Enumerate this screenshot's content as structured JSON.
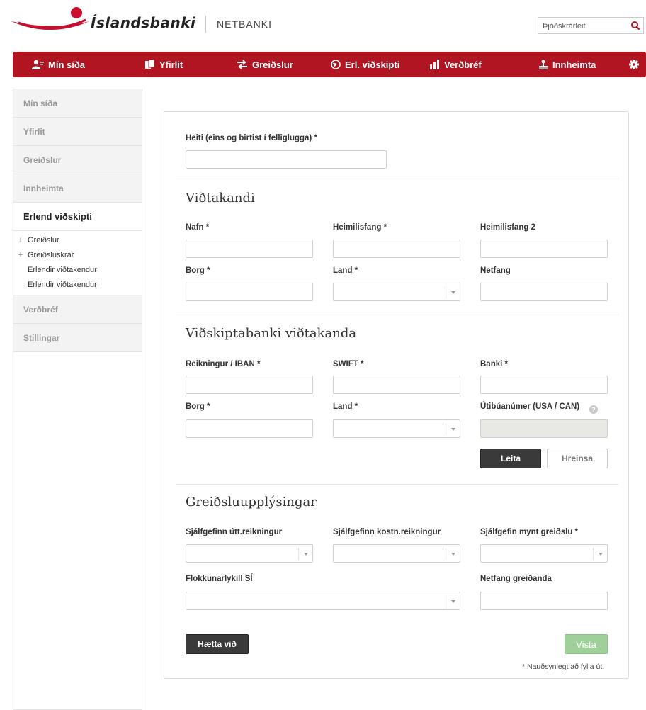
{
  "brand": {
    "name": "Íslandsbanki",
    "product": "NETBANKI",
    "color": "#b11522"
  },
  "search": {
    "placeholder": "Þjóðskrárleit"
  },
  "nav": {
    "items": [
      {
        "label": "Mín síða",
        "icon": "person-icon"
      },
      {
        "label": "Yfirlit",
        "icon": "documents-icon"
      },
      {
        "label": "Greiðslur",
        "icon": "transfer-arrows-icon"
      },
      {
        "label": "Erl. viðskipti",
        "icon": "globe-icon"
      },
      {
        "label": "Verðbréf",
        "icon": "bar-chart-icon"
      },
      {
        "label": "Innheimta",
        "icon": "stamp-icon"
      }
    ],
    "settings_icon": "gear-icon"
  },
  "sidebar": {
    "items": [
      {
        "label": "Mín síða"
      },
      {
        "label": "Yfirlit"
      },
      {
        "label": "Greiðslur"
      },
      {
        "label": "Innheimta"
      },
      {
        "label": "Erlend viðskipti"
      },
      {
        "label": "Verðbréf"
      },
      {
        "label": "Stillingar"
      }
    ],
    "sub_items": [
      {
        "label": "Greiðslur"
      },
      {
        "label": "Greiðsluskrár"
      },
      {
        "label": "Erlendir viðtakendur"
      },
      {
        "label": "Erlendir viðtakendur"
      }
    ]
  },
  "form": {
    "name_label": "Heiti (eins og birtist í felliglugga) *",
    "recipient": {
      "title": "Viðtakandi",
      "name": "Nafn *",
      "address": "Heimilisfang *",
      "address2": "Heimilisfang 2",
      "city": "Borg *",
      "country": "Land *",
      "email": "Netfang"
    },
    "bank": {
      "title": "Viðskiptabanki viðtakanda",
      "account": "Reikningur / IBAN *",
      "swift": "SWIFT *",
      "bank": "Banki *",
      "city": "Borg *",
      "country": "Land *",
      "branch": "Útibúanúmer (USA / CAN)",
      "search_button": "Leita",
      "clear_button": "Hreinsa"
    },
    "payment": {
      "title": "Greiðsluupplýsingar",
      "default_account": "Sjálfgefinn útt.reikningur",
      "default_cost_account": "Sjálfgefinn kostn.reikningur",
      "default_currency": "Sjálfgefin mynt greiðslu *",
      "category_key": "Flokkunarlykill SÍ",
      "payer_email": "Netfang greiðanda"
    },
    "cancel_button": "Hætta við",
    "save_button": "Vista",
    "required_note": "* Nauðsynlegt að fylla út."
  }
}
